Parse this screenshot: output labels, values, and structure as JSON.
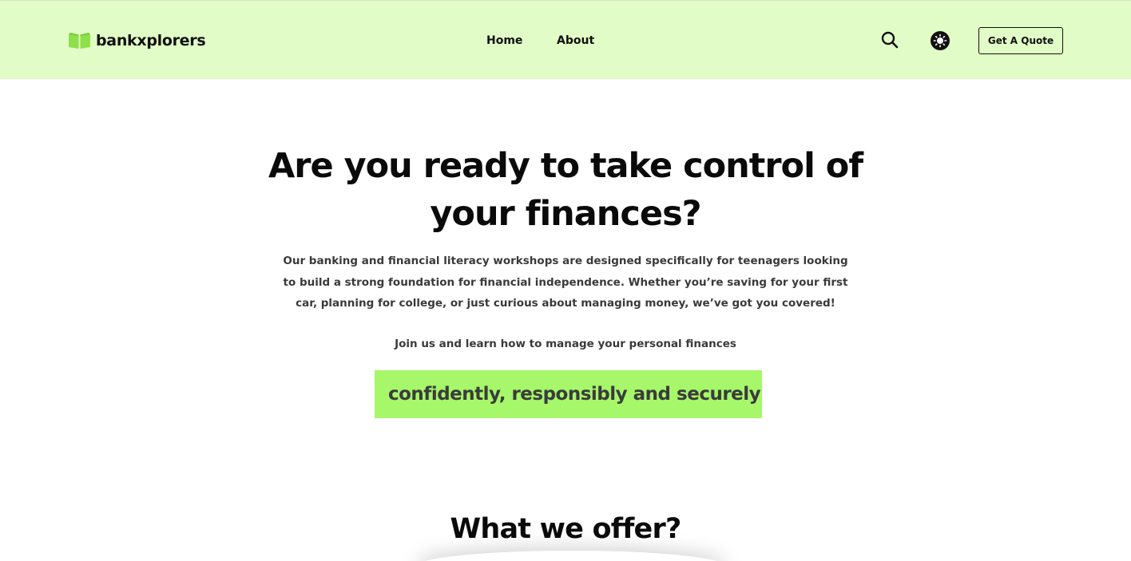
{
  "header": {
    "brand": "bankxplorers",
    "nav": [
      {
        "label": "Home"
      },
      {
        "label": "About"
      }
    ],
    "search_icon": "search-icon",
    "theme_icon": "sun-icon",
    "cta_label": "Get A Quote"
  },
  "hero": {
    "title": "Are you ready to take control of your finances?",
    "description": "Our banking and financial literacy workshops are designed specifically for teenagers looking to build a strong foundation for financial independence. Whether you’re saving for your first car, planning for college, or just curious about managing money, we’ve got you covered!",
    "join_text": "Join us and learn how to manage your personal finances",
    "highlight": "confidently, responsibly and securely"
  },
  "offer": {
    "title": "What we offer?"
  },
  "colors": {
    "header_bg": "#e1fcc6",
    "accent_green": "#a6f76a",
    "logo_green": "#8ee04a",
    "text_dark": "#0a0a0a"
  }
}
